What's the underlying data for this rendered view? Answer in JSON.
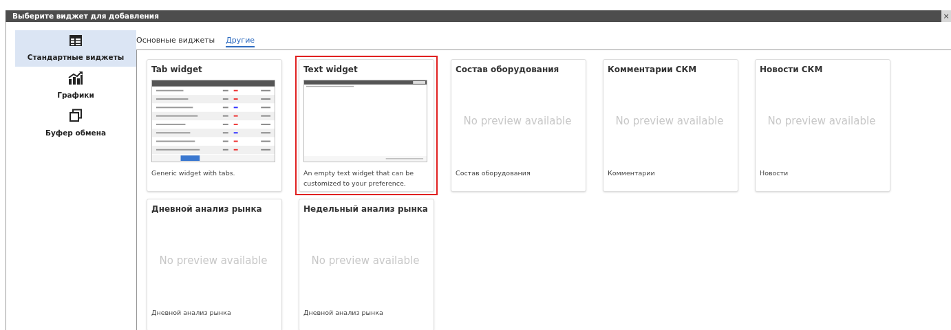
{
  "dialog": {
    "title": "Выберите виджет для добавления",
    "close": "×"
  },
  "sidebar": {
    "items": [
      {
        "kind": "table",
        "label": "Стандартные виджеты",
        "selected": true
      },
      {
        "kind": "chart",
        "label": "Графики",
        "selected": false
      },
      {
        "kind": "copy",
        "label": "Буфер обмена",
        "selected": false
      }
    ]
  },
  "tabs": [
    {
      "label": "Основные виджеты",
      "selected": false
    },
    {
      "label": "Другие",
      "selected": true
    }
  ],
  "widgets": [
    {
      "title": "Tab widget",
      "kind": "table",
      "description": "Generic widget with tabs.",
      "highlighted": false
    },
    {
      "title": "Text widget",
      "kind": "text",
      "description": "An empty text widget that can be customized to your preference.",
      "highlighted": true
    },
    {
      "title": "Состав оборудования",
      "kind": "none",
      "no_preview": "No preview available",
      "description": "Состав оборудования",
      "highlighted": false
    },
    {
      "title": "Комментарии СКМ",
      "kind": "none",
      "no_preview": "No preview available",
      "description": "Комментарии",
      "highlighted": false
    },
    {
      "title": "Новости СКМ",
      "kind": "none",
      "no_preview": "No preview available",
      "description": "Новости",
      "highlighted": false
    },
    {
      "title": "Дневной анализ рынка",
      "kind": "none",
      "no_preview": "No preview available",
      "description": "Дневной анализ рынка",
      "highlighted": false
    },
    {
      "title": "Недельный анализ рынка",
      "kind": "none",
      "no_preview": "No preview available",
      "description": "Дневной анализ рынка",
      "highlighted": false
    }
  ]
}
